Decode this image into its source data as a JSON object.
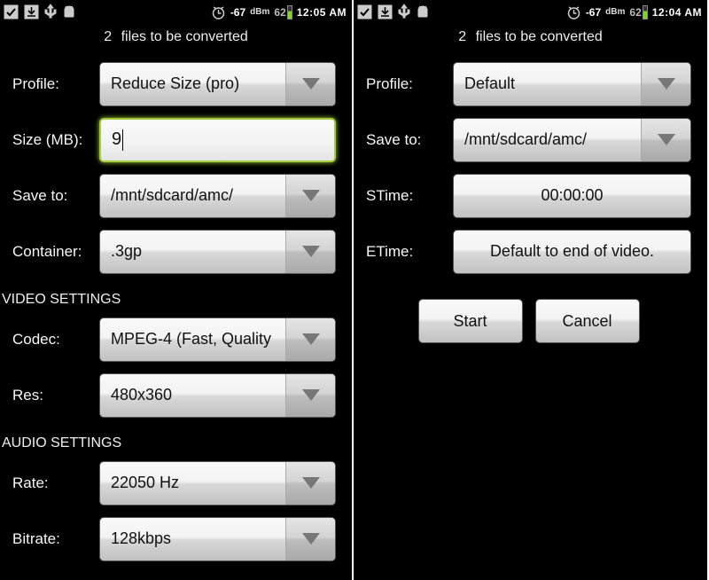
{
  "left": {
    "statusbar": {
      "signal": "-67",
      "dbm": "dBm",
      "batt": "62",
      "time": "12:05 AM"
    },
    "subhead": {
      "count": "2",
      "text": "files to be converted"
    },
    "labels": {
      "profile": "Profile:",
      "size": "Size (MB):",
      "saveto": "Save to:",
      "container": "Container:",
      "video_section": "VIDEO SETTINGS",
      "codec": "Codec:",
      "res": "Res:",
      "audio_section": "AUDIO SETTINGS",
      "rate": "Rate:",
      "bitrate": "Bitrate:"
    },
    "values": {
      "profile": "Reduce Size (pro)",
      "size": "9",
      "saveto": "/mnt/sdcard/amc/",
      "container": ".3gp",
      "codec": "MPEG-4 (Fast, Quality",
      "res": "480x360",
      "rate": "22050 Hz",
      "bitrate": "128kbps"
    }
  },
  "right": {
    "statusbar": {
      "signal": "-67",
      "dbm": "dBm",
      "batt": "62",
      "time": "12:04 AM"
    },
    "subhead": {
      "count": "2",
      "text": "files to be converted"
    },
    "labels": {
      "profile": "Profile:",
      "saveto": "Save to:",
      "stime": "STime:",
      "etime": "ETime:",
      "start": "Start",
      "cancel": "Cancel"
    },
    "values": {
      "profile": "Default",
      "saveto": "/mnt/sdcard/amc/",
      "stime": "00:00:00",
      "etime": "Default to end of video."
    }
  }
}
